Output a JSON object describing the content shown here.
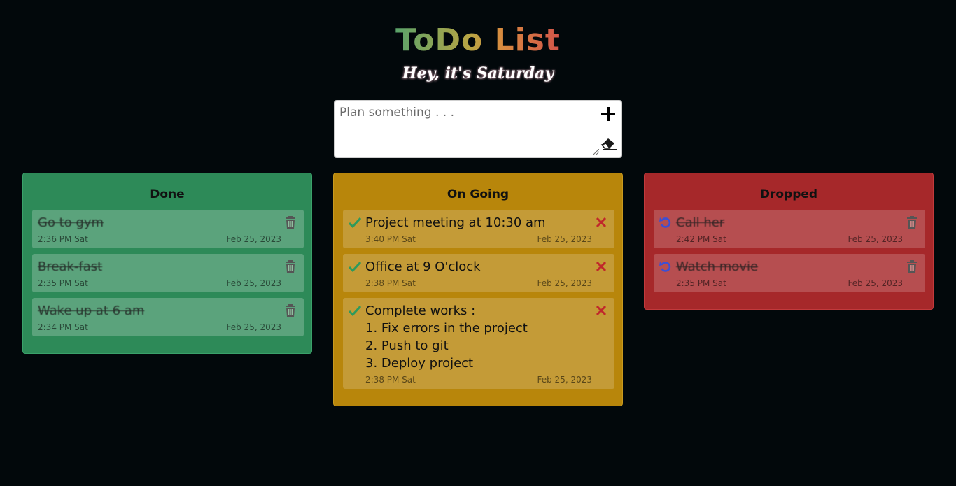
{
  "header": {
    "title": "ToDo List",
    "subtitle": "Hey, it's Saturday"
  },
  "input": {
    "placeholder": "Plan something . . .",
    "value": "",
    "add_icon": "plus-icon",
    "clear_icon": "eraser-icon"
  },
  "columns": {
    "done": {
      "title": "Done",
      "color": "#2d8a58",
      "items": [
        {
          "text": "Go to gym",
          "time": "2:36 PM Sat",
          "date": "Feb 25, 2023"
        },
        {
          "text": "Break-fast",
          "time": "2:35 PM Sat",
          "date": "Feb 25, 2023"
        },
        {
          "text": "Wake up at 6 am",
          "time": "2:34 PM Sat",
          "date": "Feb 25, 2023"
        }
      ]
    },
    "ongoing": {
      "title": "On Going",
      "color": "#b8860b",
      "items": [
        {
          "text": "Project meeting at 10:30 am",
          "time": "3:40 PM Sat",
          "date": "Feb 25, 2023"
        },
        {
          "text": "Office at 9 O'clock",
          "time": "2:38 PM Sat",
          "date": "Feb 25, 2023"
        },
        {
          "text": "Complete works :\n1. Fix errors in the project\n2. Push to git\n3. Deploy project",
          "time": "2:38 PM Sat",
          "date": "Feb 25, 2023"
        }
      ]
    },
    "dropped": {
      "title": "Dropped",
      "color": "#a6282a",
      "items": [
        {
          "text": "Call her",
          "time": "2:42 PM Sat",
          "date": "Feb 25, 2023"
        },
        {
          "text": "Watch movie",
          "time": "2:35 PM Sat",
          "date": "Feb 25, 2023"
        }
      ]
    }
  },
  "colors": {
    "background": "#02080b",
    "check": "#2e9a5c",
    "cross": "#c0282b",
    "undo": "#3b4fd6",
    "trash": "#555555"
  }
}
